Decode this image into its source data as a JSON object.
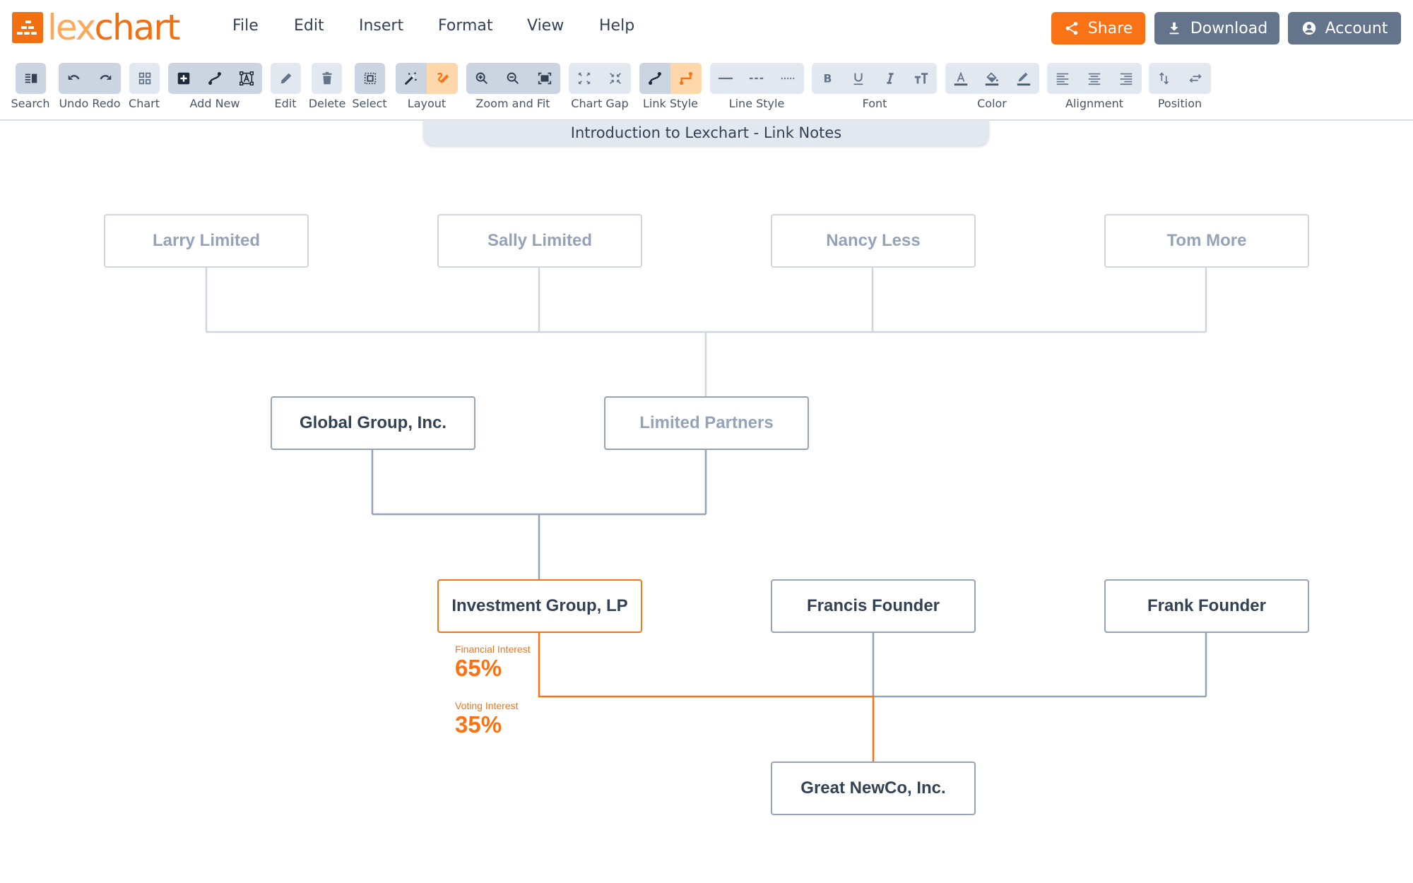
{
  "app": {
    "name_part1": "lex",
    "name_part2": "chart"
  },
  "menu": [
    "File",
    "Edit",
    "Insert",
    "Format",
    "View",
    "Help"
  ],
  "header_buttons": {
    "share": "Share",
    "download": "Download",
    "account": "Account"
  },
  "colors": {
    "brand_orange": "#f26f12",
    "accent_orange": "#f97316",
    "slate_button": "#64748b",
    "active_toolbar": "#cbd5e1",
    "inactive_toolbar": "#e2e8f0",
    "highlight_toolbar": "#fed7aa"
  },
  "toolbar": {
    "groups": [
      {
        "label": "Search",
        "icons": [
          "search-panel-icon"
        ]
      },
      {
        "label": "Undo Redo",
        "icons": [
          "undo-icon",
          "redo-icon"
        ]
      },
      {
        "label": "Chart",
        "icons": [
          "chart-grid-icon"
        ]
      },
      {
        "label": "Add New",
        "icons": [
          "add-box-icon",
          "add-link-icon",
          "add-text-icon"
        ]
      },
      {
        "label": "Edit",
        "icons": [
          "pencil-icon"
        ]
      },
      {
        "label": "Delete",
        "icons": [
          "trash-icon"
        ]
      },
      {
        "label": "Select",
        "icons": [
          "select-icon"
        ]
      },
      {
        "label": "Layout",
        "icons": [
          "auto-layout-wand-icon",
          "manual-layout-icon"
        ]
      },
      {
        "label": "Zoom and Fit",
        "icons": [
          "zoom-in-icon",
          "zoom-out-icon",
          "fit-screen-icon"
        ]
      },
      {
        "label": "Chart Gap",
        "icons": [
          "expand-gap-icon",
          "shrink-gap-icon"
        ]
      },
      {
        "label": "Link Style",
        "icons": [
          "curved-link-icon",
          "elbow-link-icon"
        ]
      },
      {
        "label": "Line Style",
        "icons": [
          "solid-line-icon",
          "dashed-line-icon",
          "dotted-line-icon"
        ]
      },
      {
        "label": "Font",
        "icons": [
          "bold-icon",
          "underline-icon",
          "italic-icon",
          "text-size-icon"
        ]
      },
      {
        "label": "Color",
        "icons": [
          "text-color-icon",
          "fill-color-icon",
          "line-color-icon"
        ]
      },
      {
        "label": "Alignment",
        "icons": [
          "align-left-icon",
          "align-center-icon",
          "align-right-icon"
        ]
      },
      {
        "label": "Position",
        "icons": [
          "swap-vertical-icon",
          "swap-horizontal-icon"
        ]
      }
    ]
  },
  "chart_title": "Introduction to Lexchart - Link Notes",
  "nodes": {
    "larry": "Larry Limited",
    "sally": "Sally Limited",
    "nancy": "Nancy Less",
    "tom": "Tom More",
    "global": "Global Group, Inc.",
    "limited_partners": "Limited Partners",
    "investment": "Investment Group, LP",
    "francis": "Francis Founder",
    "frank": "Frank Founder",
    "newco": "Great NewCo, Inc."
  },
  "link_notes": {
    "financial_label": "Financial Interest",
    "financial_value": "65%",
    "voting_label": "Voting Interest",
    "voting_value": "35%"
  }
}
